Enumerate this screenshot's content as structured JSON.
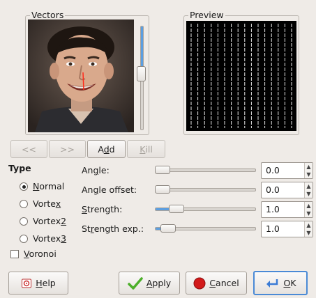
{
  "vectors": {
    "label": "Vectors",
    "slider_level": 0.45
  },
  "preview": {
    "label": "Preview"
  },
  "nav_buttons": {
    "prev": "<<",
    "next": ">>",
    "add": "Add",
    "kill": "Kill"
  },
  "type": {
    "heading": "Type",
    "options": [
      {
        "label": "Normal",
        "selected": true
      },
      {
        "label": "Vortex",
        "selected": false
      },
      {
        "label": "Vortex2",
        "selected": false
      },
      {
        "label": "Vortex3",
        "selected": false
      }
    ],
    "voronoi": {
      "label": "Voronoi",
      "checked": false
    }
  },
  "params": [
    {
      "label": "Angle:",
      "value": "0.0",
      "level": 0.0
    },
    {
      "label": "Angle offset:",
      "value": "0.0",
      "level": 0.0
    },
    {
      "label": "Strength:",
      "value": "1.0",
      "level": 0.2
    },
    {
      "label": "Strength exp.:",
      "value": "1.0",
      "level": 0.1
    }
  ],
  "actions": {
    "help": "Help",
    "apply": "Apply",
    "cancel": "Cancel",
    "ok": "OK"
  },
  "colors": {
    "accent": "#5b9ee0",
    "default_border": "#4a8ad6",
    "apply_check": "#4caf2a",
    "cancel_icon": "#d21a1a"
  }
}
